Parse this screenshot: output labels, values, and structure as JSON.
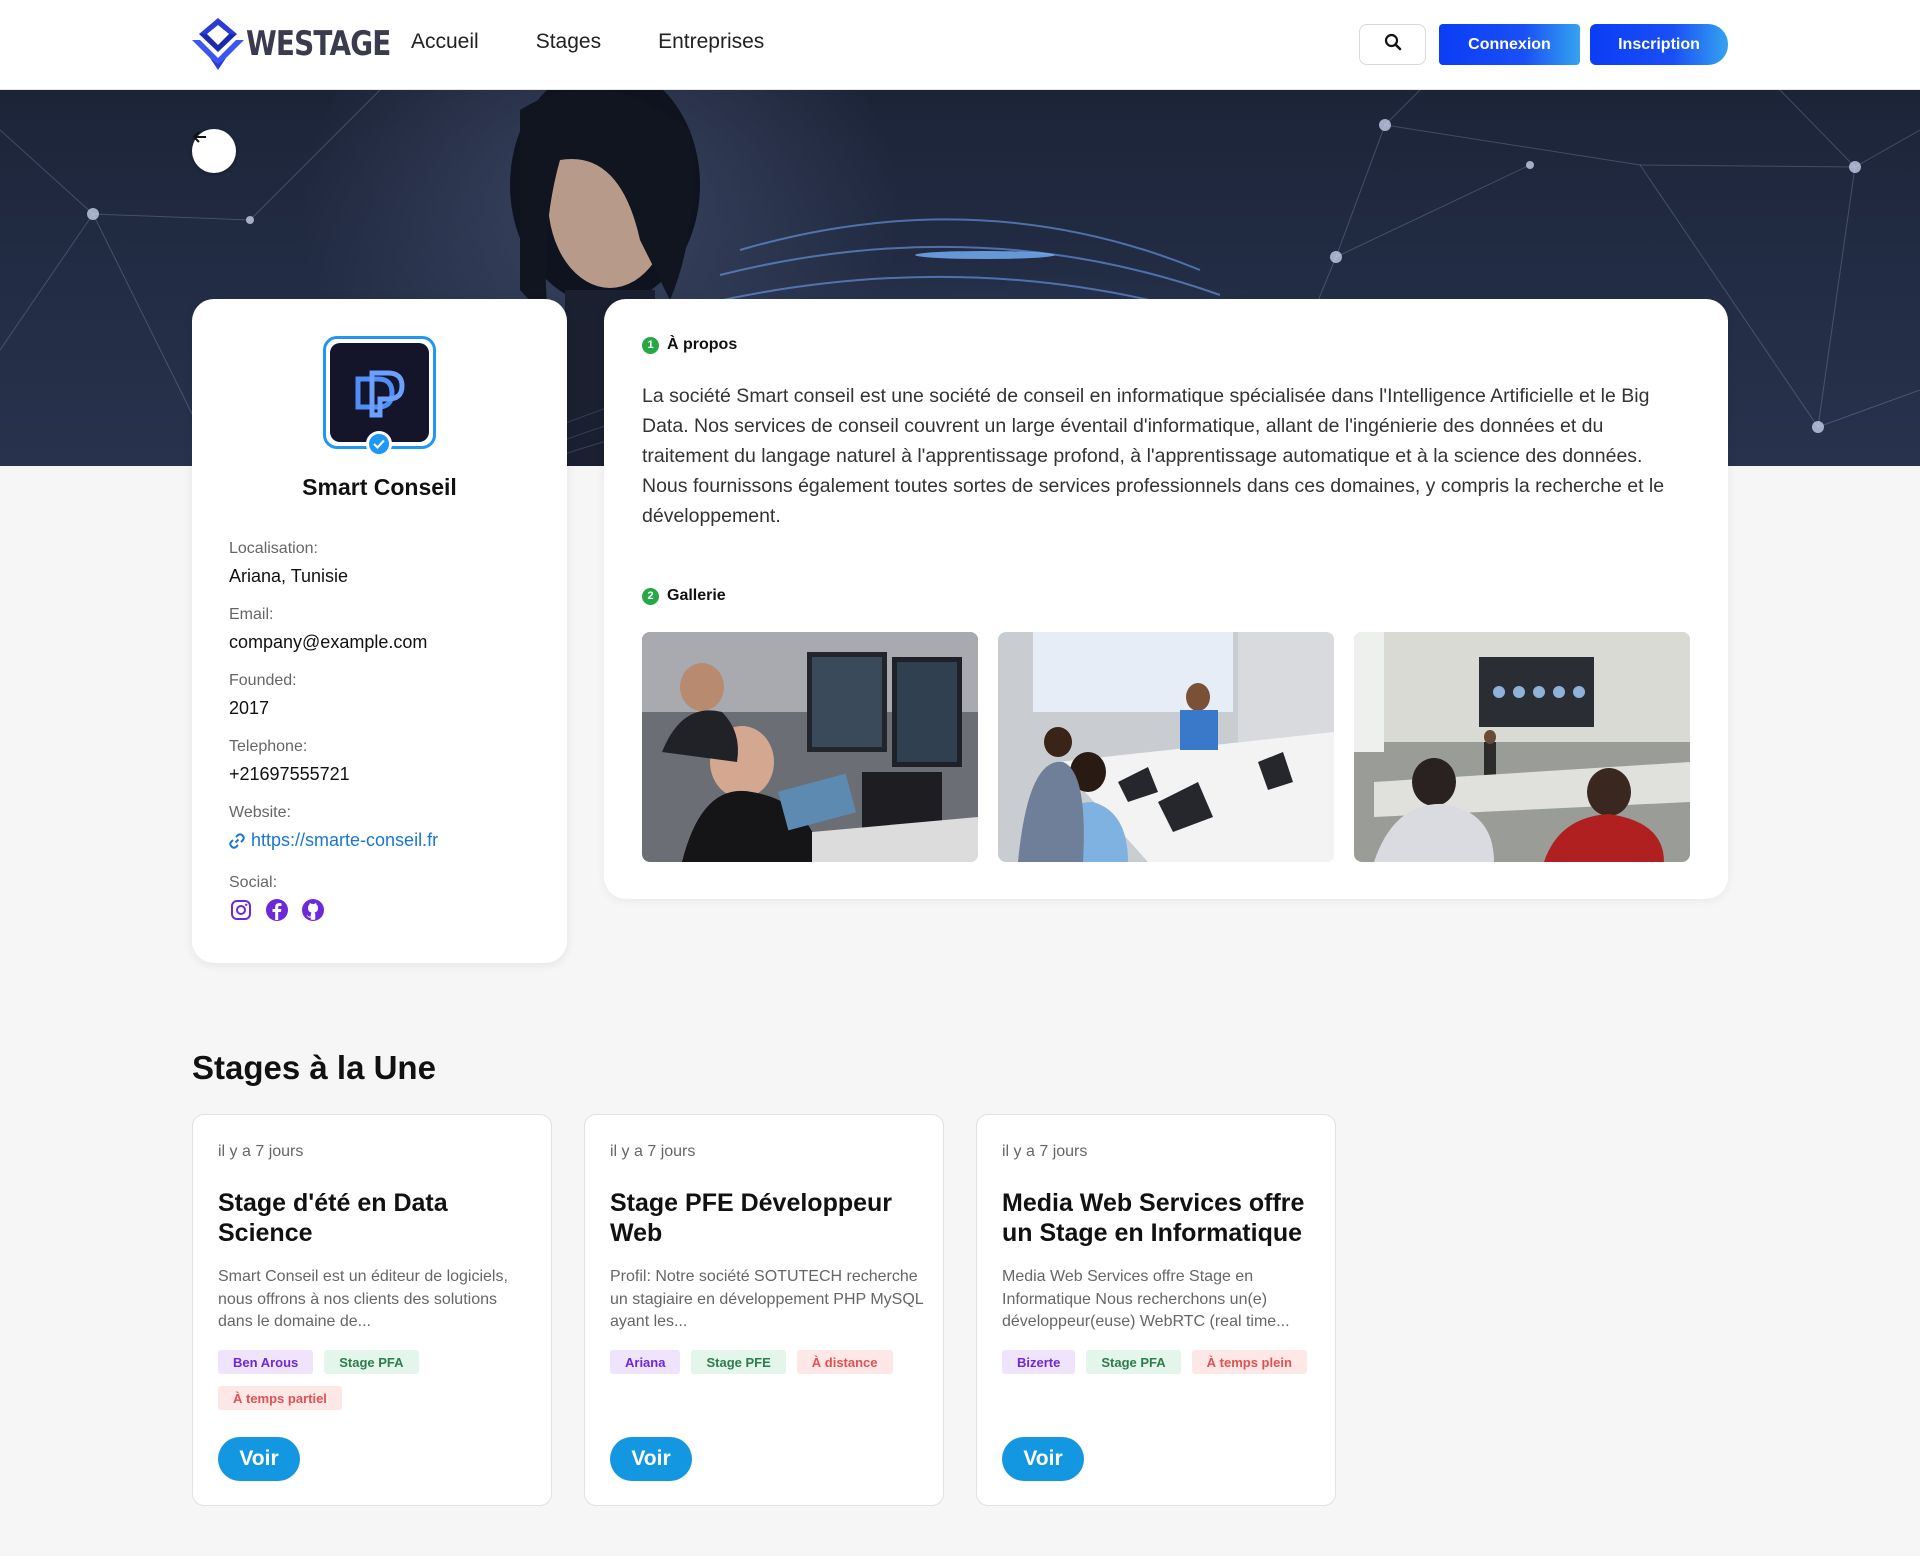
{
  "nav": {
    "logo_text": "WESTAGE",
    "links": [
      "Accueil",
      "Stages",
      "Entreprises"
    ],
    "login": "Connexion",
    "register": "Inscription",
    "icons": {
      "search": "search-icon",
      "back": "arrow-left-icon"
    }
  },
  "colors": {
    "primary": "#0b3df5",
    "accent": "#1397e0",
    "verified": "#2196f3",
    "section_num": "#28a745"
  },
  "company": {
    "name": "Smart Conseil",
    "fields": [
      {
        "label": "Localisation:",
        "value": "Ariana, Tunisie"
      },
      {
        "label": "Email:",
        "value": "company@example.com"
      },
      {
        "label": "Founded:",
        "value": "2017"
      },
      {
        "label": "Telephone:",
        "value": "+21697555721"
      },
      {
        "label": "Website:",
        "value": "https://smarte-conseil.fr"
      }
    ],
    "social_label": "Social:",
    "social": [
      "instagram-icon",
      "facebook-icon",
      "github-icon"
    ]
  },
  "about": {
    "num": "1",
    "title": "À propos",
    "text": "La société Smart conseil est une société de conseil en informatique spécialisée dans l'Intelligence Artificielle et le Big Data. Nos services de conseil couvrent un large éventail d'informatique, allant de l'ingénierie des données et du traitement du langage naturel à l'apprentissage profond, à l'apprentissage automatique et à la science des données. Nous fournissons également toutes sortes de services professionnels dans ces domaines, y compris la recherche et le développement."
  },
  "gallery": {
    "num": "2",
    "title": "Gallerie"
  },
  "stages": {
    "title": "Stages à la Une",
    "cards": [
      {
        "date": "il y a 7 jours",
        "title": "Stage d'été en Data Science",
        "desc": "Smart Conseil est un éditeur de logiciels, nous offrons à nos clients des solutions dans le domaine de...",
        "tags": [
          "Ben Arous",
          "Stage PFA",
          "À temps partiel"
        ],
        "button": "Voir"
      },
      {
        "date": "il y a 7 jours",
        "title": "Stage PFE Développeur Web",
        "desc": "Profil: Notre société SOTUTECH recherche un stagiaire en développement PHP MySQL ayant les...",
        "tags": [
          "Ariana",
          "Stage PFE",
          "À distance"
        ],
        "button": "Voir"
      },
      {
        "date": "il y a 7 jours",
        "title": "Media Web Services offre un Stage en Informatique",
        "desc": "Media Web Services offre Stage en Informatique Nous recherchons un(e) développeur(euse) WebRTC (real time...",
        "tags": [
          "Bizerte",
          "Stage PFA",
          "À temps plein"
        ],
        "button": "Voir"
      }
    ]
  }
}
